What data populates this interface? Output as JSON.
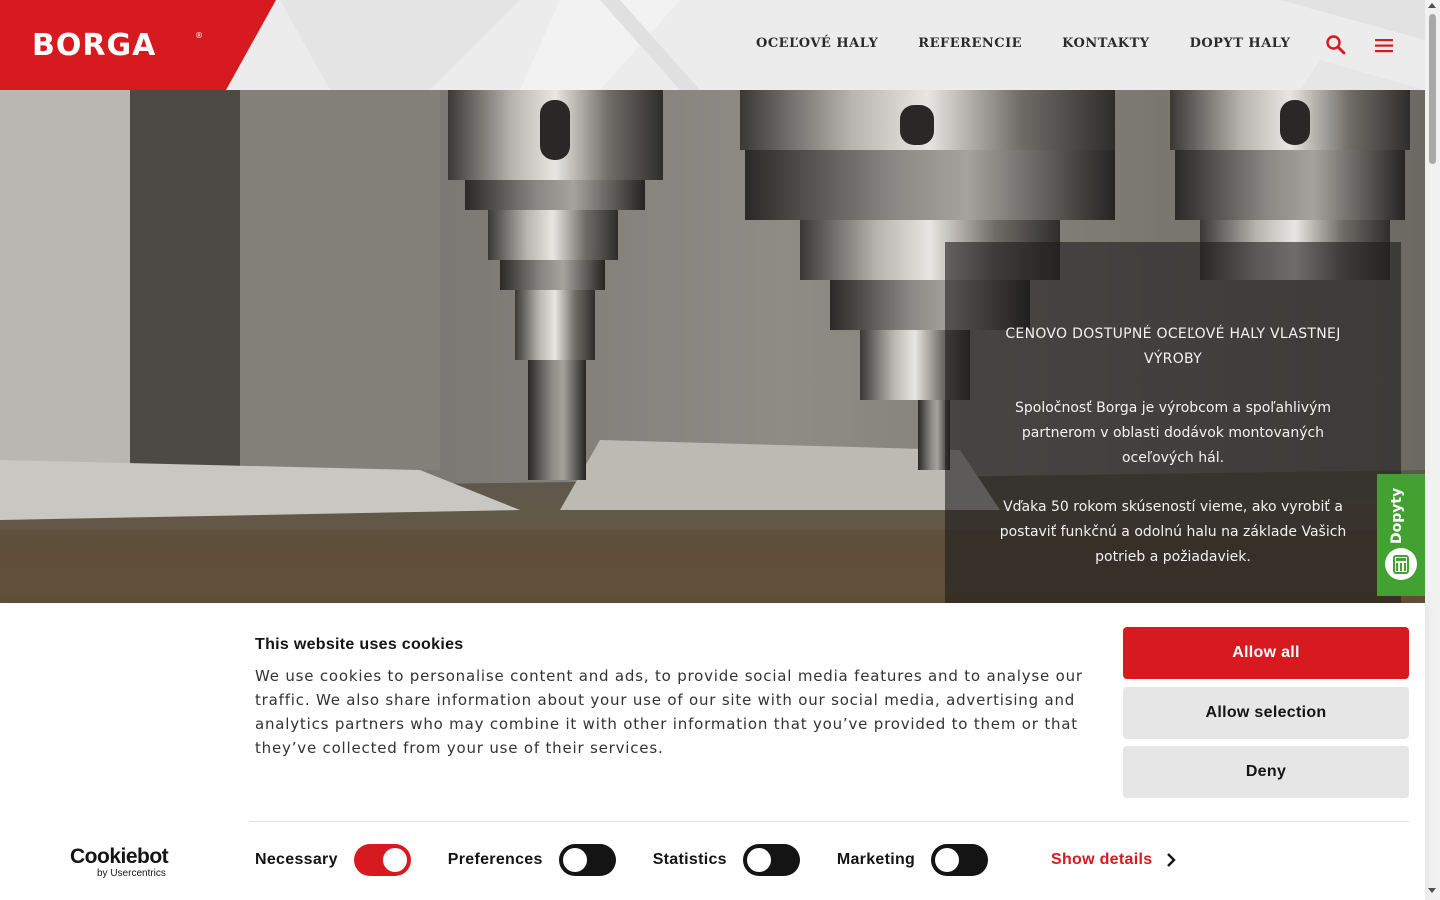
{
  "header": {
    "logo": "BORGA",
    "logo_mark": "®",
    "nav": [
      {
        "label": "OCEĽOVÉ HALY"
      },
      {
        "label": "REFERENCIE"
      },
      {
        "label": "KONTAKTY"
      },
      {
        "label": "DOPYT HALY"
      }
    ],
    "search_icon": "search-icon",
    "menu_icon": "hamburger-menu-icon",
    "brand_color": "#d71920"
  },
  "hero": {
    "title": "CENOVO DOSTUPNÉ OCEĽOVÉ HALY VLASTNEJ VÝROBY",
    "paragraphs": [
      "Spoločnosť Borga je výrobcom a spoľahlivým partnerom v oblasti dodávok montovaných oceľových hál.",
      "Vďaka 50 rokom skúseností vieme, ako vyrobiť a postaviť funkčnú a odolnú halu na základe Vašich potrieb a požiadaviek."
    ]
  },
  "side_tab": {
    "label": "Dopyty",
    "icon": "calculator-icon",
    "color": "#43a132"
  },
  "cookie_banner": {
    "title": "This website uses cookies",
    "text": "We use cookies to personalise content and ads, to provide social media features and to analyse our traffic. We also share information about your use of our site with our social media, advertising and analytics partners who may combine it with other information that you’ve provided to them or that they’ve collected from your use of their services.",
    "buttons": {
      "allow_all": "Allow all",
      "allow_selection": "Allow selection",
      "deny": "Deny"
    },
    "toggles": [
      {
        "label": "Necessary",
        "on": true
      },
      {
        "label": "Preferences",
        "on": false
      },
      {
        "label": "Statistics",
        "on": false
      },
      {
        "label": "Marketing",
        "on": false
      }
    ],
    "show_details": "Show details",
    "cookiebot_brand": "Cookiebot",
    "cookiebot_sub": "by Usercentrics"
  }
}
